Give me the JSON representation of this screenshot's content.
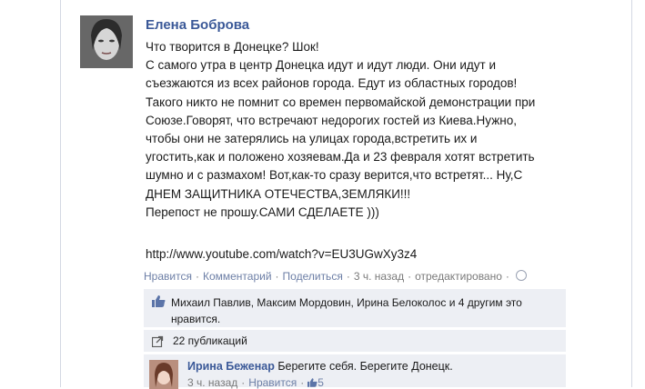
{
  "post": {
    "author": "Елена Боброва",
    "lines": [
      "Что творится в Донецке? Шок!",
      "С самого утра в центр Донецка идут и идут люди. Они идут и",
      "съезжаются из всех районов города. Едут из областных городов!",
      "Такого никто не помнит со времен первомайской демонстрации при",
      "Союзе.Говорят, что встречают недорогих гостей из Киева.Нужно,",
      "чтобы они не затерялись на улицах города,встретить их и",
      "угостить,как и положено хозяевам.Да и 23 февраля хотят встретить",
      "шумно и с размахом! Вот,как-то сразу верится,что встретят... Ну,С",
      "ДНЕМ ЗАЩИТНИКА ОТЕЧЕСТВА,ЗЕМЛЯКИ!!!",
      "Перепост не прошу.САМИ СДЕЛАЕТЕ )))"
    ],
    "link": "http://www.youtube.com/watch?v=EU3UGwXy3z4",
    "actions": {
      "like": "Нравится",
      "comment": "Комментарий",
      "share": "Поделиться",
      "time": "3 ч. назад",
      "edited": "отредактировано"
    },
    "likes_text": "Михаил Павлив, Максим Мордовин, Ирина Белоколос и 4 другим это нравится.",
    "shares_text": "22 публикаций",
    "icons": {
      "thumb": "thumbs-up-icon",
      "share": "share-icon",
      "privacy": "globe-icon",
      "colors": {
        "link": "#3b5998",
        "panel": "#edeff4"
      }
    }
  },
  "comment": {
    "author": "Ирина Беженар",
    "text": "Берегите себя. Берегите Донецк.",
    "time": "3 ч. назад",
    "like": "Нравится",
    "like_count": "5"
  }
}
